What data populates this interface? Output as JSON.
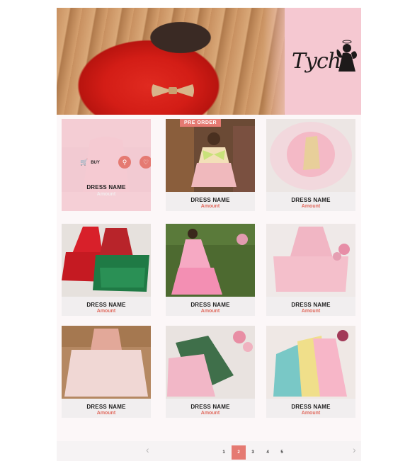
{
  "brand": {
    "logo_text": "Tyche"
  },
  "badges": {
    "pre_order": "PRE ORDER"
  },
  "hover_card": {
    "buy_label": "BUY",
    "link_icon": "link-icon",
    "wishlist_icon": "heart-icon"
  },
  "products": [
    {
      "name": "DRESS NAME",
      "amount": "Amount"
    },
    {
      "name": "DRESS NAME",
      "amount": "Amount"
    },
    {
      "name": "DRESS NAME",
      "amount": "Amount"
    },
    {
      "name": "DRESS NAME",
      "amount": "Amount"
    },
    {
      "name": "DRESS NAME",
      "amount": "Amount"
    },
    {
      "name": "DRESS NAME",
      "amount": "Amount"
    },
    {
      "name": "DRESS NAME",
      "amount": "Amount"
    },
    {
      "name": "DRESS NAME",
      "amount": "Amount"
    },
    {
      "name": "DRESS NAME",
      "amount": "Amount"
    }
  ],
  "pagination": {
    "prev": "‹",
    "next": "›",
    "pages": [
      "1",
      "2",
      "3",
      "4",
      "5"
    ],
    "current": "2"
  },
  "colors": {
    "accent": "#e57a72",
    "banner_pink": "#f5c8d1",
    "amount": "#e0695d"
  }
}
